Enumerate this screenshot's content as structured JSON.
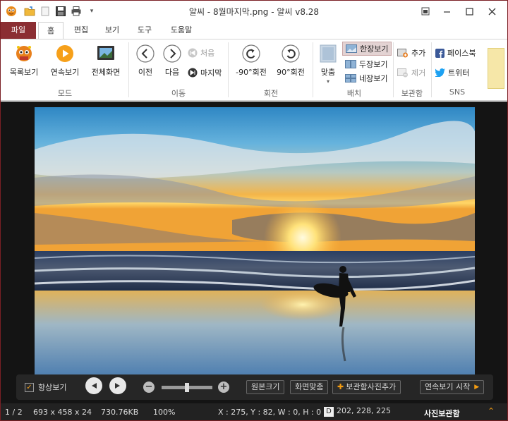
{
  "window": {
    "title": "알씨 - 8월마지막.png - 알씨 v8.28",
    "controls": [
      "pin",
      "minimize",
      "maximize",
      "close"
    ]
  },
  "quick_access": [
    "app-logo-icon",
    "open-folder-icon",
    "new-icon",
    "save-icon",
    "print-icon",
    "customize-icon"
  ],
  "menu": {
    "file": "파일",
    "tabs": [
      "홈",
      "편집",
      "보기",
      "도구",
      "도움말"
    ],
    "active": "홈"
  },
  "ribbon": {
    "groups": {
      "mode": "모드",
      "move": "이동",
      "rotate": "회전",
      "layout": "배치",
      "storage": "보관함",
      "sns": "SNS"
    },
    "mode": {
      "list_view": "목록보기",
      "slideshow": "연속보기",
      "fullscreen": "전체화면"
    },
    "move": {
      "prev": "이전",
      "next": "다음",
      "first": "처음",
      "last": "마지막"
    },
    "rotate": {
      "left": "-90°회전",
      "right": "90°회전"
    },
    "layout": {
      "fit": "맞춤",
      "single": "한장보기",
      "double": "두장보기",
      "quad": "네장보기",
      "selected": "한장보기"
    },
    "storage": {
      "add": "추가",
      "remove": "제거"
    },
    "sns": {
      "facebook": "페이스북",
      "twitter": "트위터"
    }
  },
  "toolbar": {
    "always_show": "항상보기",
    "always_show_checked": true,
    "original_size": "원본크기",
    "fit_screen": "화면맞춤",
    "add_to_storage": "보관함사진추가",
    "start_slideshow": "연속보기 시작"
  },
  "status": {
    "position": "1 / 2",
    "dimensions": "693 x 458 x 24",
    "file_size": "730.76KB",
    "zoom": "100%",
    "cursor": "X : 275, Y : 82, W : 0, H : 0",
    "color_mode": "D",
    "rgb": "202, 228, 225",
    "photo_storage": "사진보관함"
  },
  "colors": {
    "accent": "#8b2e33",
    "viewer_bg": "#141414",
    "status_bg": "#222222",
    "highlight": "#f7a21b"
  }
}
